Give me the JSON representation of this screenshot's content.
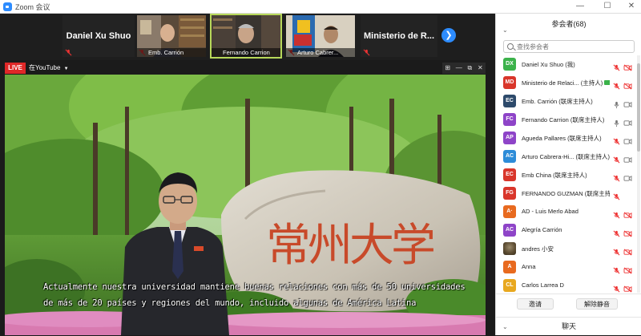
{
  "window": {
    "title": "Zoom 会议",
    "controls": [
      "—",
      "☐",
      "✕"
    ]
  },
  "gallery": {
    "tiles": [
      {
        "type": "name",
        "name": "Daniel Xu Shuo"
      },
      {
        "type": "video",
        "label": "Emb. Carrión"
      },
      {
        "type": "video",
        "label": "Fernando Carrion",
        "active": true
      },
      {
        "type": "video",
        "label": "Arturo Cabrer..."
      },
      {
        "type": "name",
        "name": "Ministerio de R..."
      }
    ],
    "next_icon": "arrow-right-icon"
  },
  "live": {
    "badge": "LIVE",
    "platform": "在YouTube",
    "minicontrols": [
      "⊞",
      "—",
      "⧉",
      "✕"
    ]
  },
  "video": {
    "subtitle_line1": "Actualmente nuestra universidad mantiene buenas relaciones con más de 50 universidades",
    "subtitle_line2": "de más de 20 países y regiones del mundo, incluido algunas de América Latina",
    "rock_text": "常州大学"
  },
  "participants_panel": {
    "title": "参会者(68)",
    "search_placeholder": "查找参会者",
    "participants": [
      {
        "initials": "DX",
        "color": "#3bb24a",
        "name": "Daniel Xu Shuo (我)",
        "mic": "muted-red",
        "cam": "off-red"
      },
      {
        "initials": "MD",
        "color": "#d9362b",
        "name": "Ministerio de Relaci... (主持人)",
        "host_tag": true,
        "mic": "muted-red",
        "cam": "off-red"
      },
      {
        "initials": "EC",
        "color": "#2d4a6b",
        "name": "Emb. Carrión (联席主持人)",
        "mic": "on-gray",
        "cam": "on-gray"
      },
      {
        "initials": "FC",
        "color": "#8e44c8",
        "name": "Fernando Carrion (联席主持人)",
        "mic": "on-gray",
        "cam": "on-gray"
      },
      {
        "initials": "AP",
        "color": "#8e44c8",
        "name": "Agueda Pallares (联席主持人)",
        "mic": "muted-red",
        "cam": "on-gray"
      },
      {
        "initials": "AC",
        "color": "#2d8cd8",
        "name": "Arturo Cabrera-Hi... (联席主持人)",
        "mic": "muted-red",
        "cam": "on-gray"
      },
      {
        "initials": "EC",
        "color": "#d9362b",
        "name": "Emb China (联席主持人)",
        "mic": "muted-red",
        "cam": "on-gray"
      },
      {
        "initials": "FG",
        "color": "#d9362b",
        "name": "FERNANDO GUZMAN (联席主持人)",
        "mic": "muted-red",
        "cam": ""
      },
      {
        "initials": "A·",
        "color": "#e86a1f",
        "name": "AD - Luis Merlo Abad",
        "mic": "muted-red",
        "cam": "off-red"
      },
      {
        "initials": "AC",
        "color": "#8e44c8",
        "name": "Alegría Carrión",
        "mic": "muted-red",
        "cam": "off-red"
      },
      {
        "initials": "",
        "color": "#6b5a3a",
        "name": "andres 小安",
        "photo": true,
        "mic": "muted-red",
        "cam": "off-red"
      },
      {
        "initials": "A",
        "color": "#e86a1f",
        "name": "Anna",
        "mic": "muted-red",
        "cam": "off-red"
      },
      {
        "initials": "CL",
        "color": "#e8a81f",
        "name": "Carlos Larrea D",
        "mic": "muted-red",
        "cam": "off-red"
      }
    ],
    "invite_label": "邀请",
    "unmute_all_label": "解除静音",
    "chat_title": "聊天"
  }
}
